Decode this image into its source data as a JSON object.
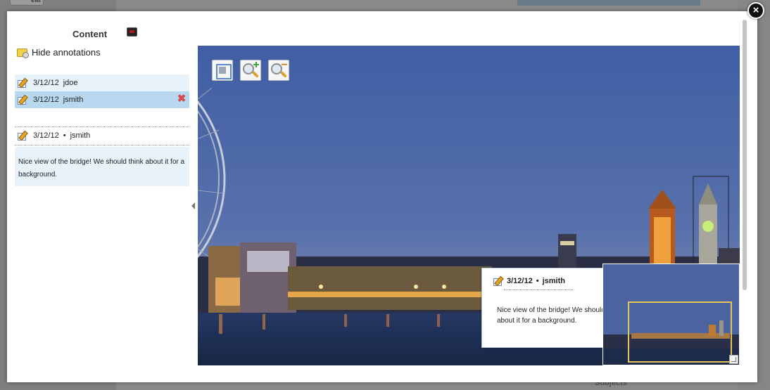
{
  "background": {
    "filter_button": "ear filters",
    "subjects_label": "Subjects"
  },
  "modal": {
    "close_symbol": "×",
    "panel_title": "Content",
    "hide_annotations_label": "Hide annotations",
    "annotations": [
      {
        "date": "3/12/12",
        "user": "jdoe",
        "selected": false
      },
      {
        "date": "3/12/12",
        "user": "jsmith",
        "selected": true
      }
    ],
    "delete_symbol": "✖",
    "detail": {
      "date": "3/12/12",
      "separator": "•",
      "user": "jsmith",
      "text": "Nice view of the bridge! We should think about it for a background."
    },
    "viewer": {
      "tools": [
        "fit-to-screen-icon",
        "zoom-in-icon",
        "zoom-out-icon"
      ],
      "zoom_in_sign": "+",
      "zoom_out_sign": "−",
      "popup": {
        "date": "3/12/12",
        "separator": "•",
        "user": "jsmith",
        "text": "Nice view of the bridge! We should think about it for a background."
      }
    }
  },
  "colors": {
    "accent": "#b8d8f0",
    "row_light": "#e8f2fb",
    "thumb_frame": "#e6c25a",
    "delete": "#d94a4a"
  }
}
